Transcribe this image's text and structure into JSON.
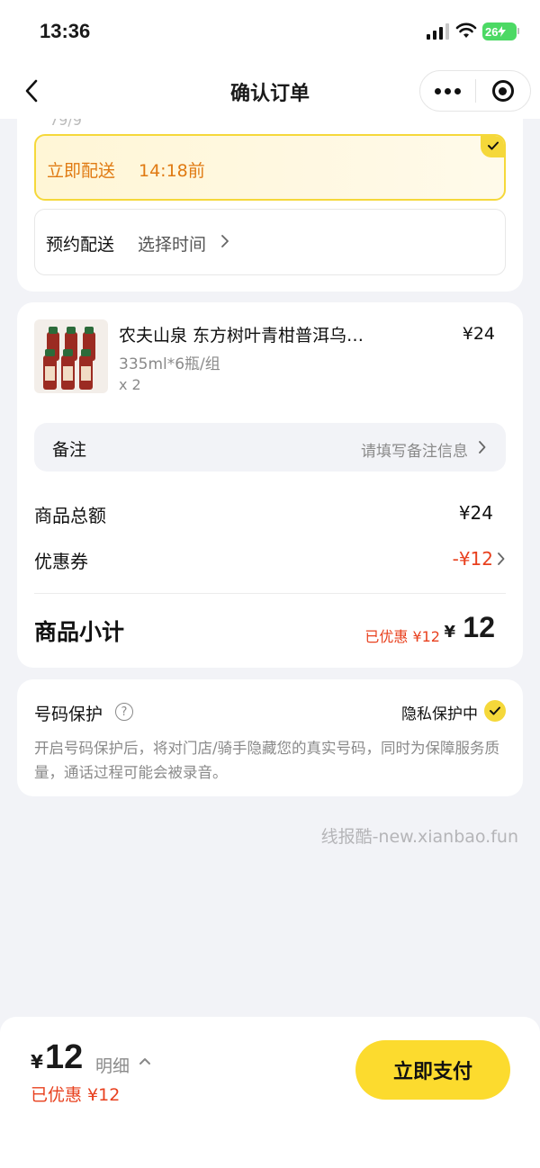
{
  "status_bar": {
    "time": "13:36",
    "battery": "26"
  },
  "nav": {
    "title": "确认订单"
  },
  "delivery": {
    "cut_text": "79/9",
    "now_label": "立即配送",
    "now_time": "14:18前",
    "later_label": "预约配送",
    "later_action": "选择时间"
  },
  "product": {
    "name": "农夫山泉 东方树叶青柑普洱乌…",
    "price": "¥24",
    "spec": "335ml*6瓶/组",
    "qty": "x 2"
  },
  "remark": {
    "label": "备注",
    "placeholder": "请填写备注信息"
  },
  "summary": {
    "total_label": "商品总额",
    "total_value": "¥24",
    "coupon_label": "优惠券",
    "coupon_value": "-¥12",
    "subtotal_label": "商品小计",
    "saved_text": "已优惠 ¥12",
    "subtotal_currency": "¥",
    "subtotal_value": "12"
  },
  "privacy": {
    "title": "号码保护",
    "status": "隐私保护中",
    "description": "开启号码保护后，将对门店/骑手隐藏您的真实号码，同时为保障服务质量，通话过程可能会被录音。"
  },
  "watermark": "线报酷-new.xianbao.fun",
  "bottom": {
    "currency": "¥",
    "amount": "12",
    "detail_label": "明细",
    "saved": "已优惠 ¥12",
    "pay_label": "立即支付"
  },
  "colors": {
    "accent_yellow": "#fcdb2e",
    "discount_red": "#e8401e",
    "orange_text": "#e07a12"
  }
}
